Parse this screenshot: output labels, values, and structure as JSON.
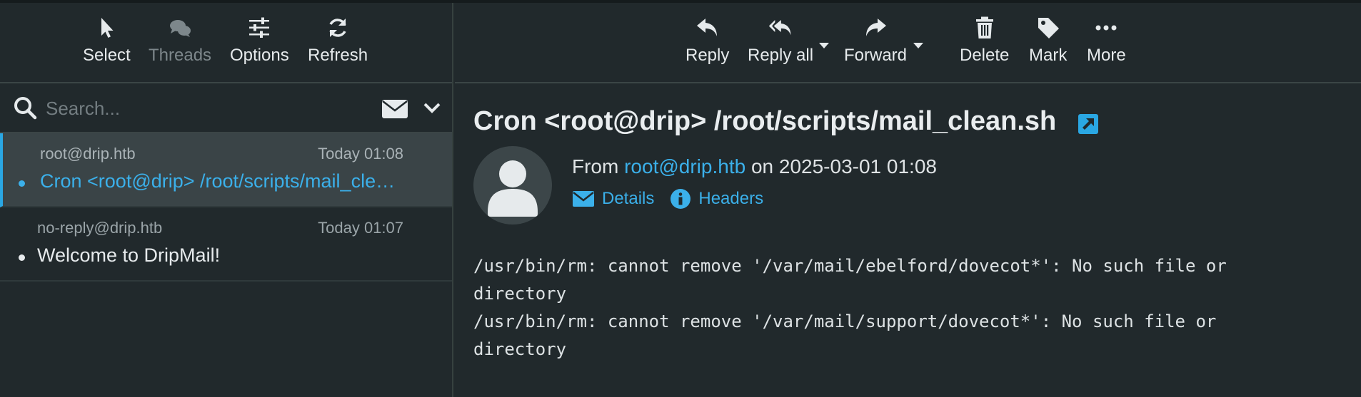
{
  "list_toolbar": {
    "select": "Select",
    "threads": "Threads",
    "options": "Options",
    "refresh": "Refresh"
  },
  "search": {
    "placeholder": "Search..."
  },
  "messages": [
    {
      "from": "root@drip.htb",
      "date": "Today 01:08",
      "subject": "Cron <root@drip> /root/scripts/mail_clean.sh",
      "selected": true
    },
    {
      "from": "no-reply@drip.htb",
      "date": "Today 01:07",
      "subject": "Welcome to DripMail!",
      "selected": false
    }
  ],
  "message_toolbar": {
    "reply": "Reply",
    "reply_all": "Reply all",
    "forward": "Forward",
    "delete": "Delete",
    "mark": "Mark",
    "more": "More"
  },
  "message": {
    "subject": "Cron <root@drip> /root/scripts/mail_clean.sh",
    "from_prefix": "From",
    "from_address": "root@drip.htb",
    "date_text": "on 2025-03-01 01:08",
    "details_label": "Details",
    "headers_label": "Headers",
    "body": "/usr/bin/rm: cannot remove '/var/mail/ebelford/dovecot*': No such file or\ndirectory\n/usr/bin/rm: cannot remove '/var/mail/support/dovecot*': No such file or\ndirectory"
  },
  "colors": {
    "accent": "#3bb0ea",
    "background": "#21292c",
    "selected_row": "#3a4447"
  },
  "icons": [
    "pointer-icon",
    "threads-icon",
    "options-icon",
    "refresh-icon",
    "search-icon",
    "envelope-icon",
    "chevron-down-icon",
    "reply-icon",
    "reply-all-icon",
    "forward-icon",
    "trash-icon",
    "tag-icon",
    "more-icon",
    "external-link-icon",
    "avatar-icon",
    "info-icon"
  ]
}
